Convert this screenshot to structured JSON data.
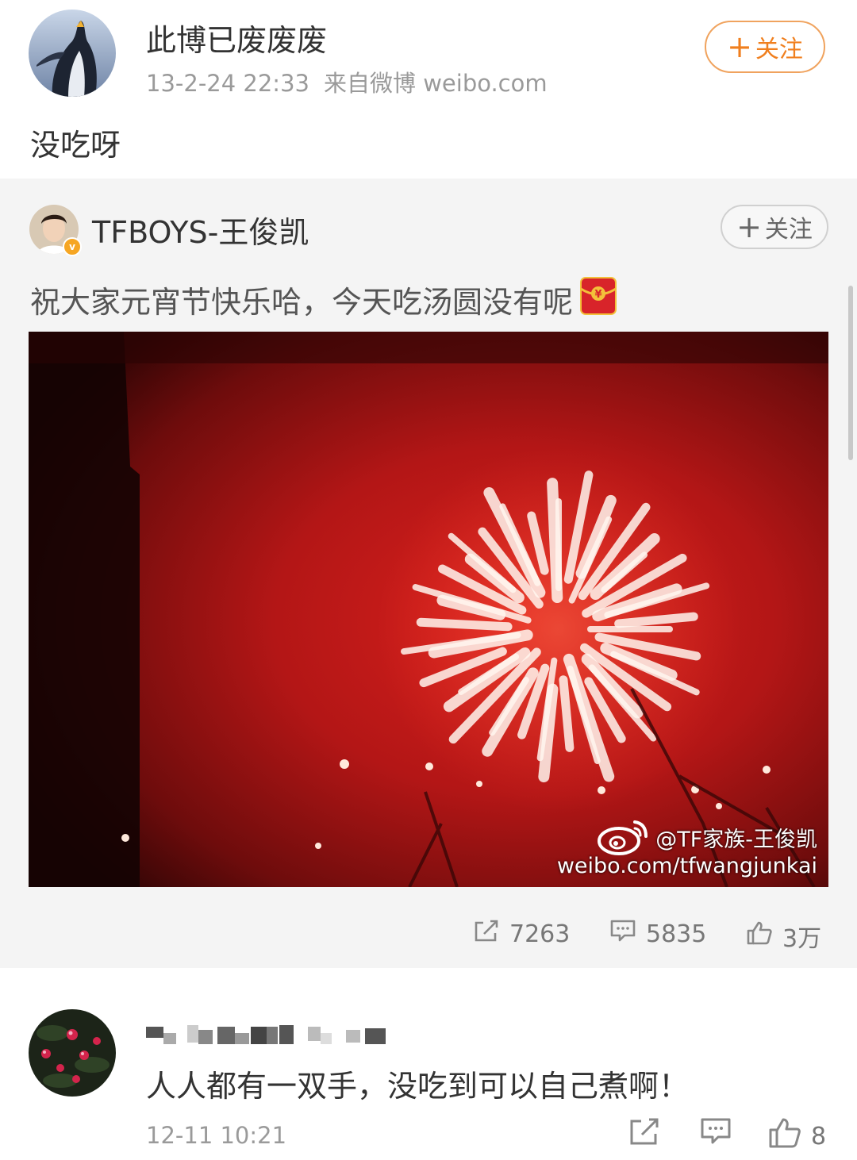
{
  "post": {
    "author": "此博已废废废",
    "time": "13-2-24 22:33",
    "source": "来自微博 weibo.com",
    "follow_label": "关注",
    "text": "没吃呀"
  },
  "repost": {
    "author": "TFBOYS-王俊凯",
    "follow_label": "关注",
    "text": "祝大家元宵节快乐哈，今天吃汤圆没有呢",
    "watermark_handle": "@TF家族-王俊凯",
    "watermark_url": "weibo.com/tfwangjunkai",
    "stats": {
      "reposts": "7263",
      "comments": "5835",
      "likes": "3万"
    }
  },
  "comment": {
    "text": "人人都有一双手，没吃到可以自己煮啊！",
    "time": "12-11 10:21",
    "likes": "8"
  },
  "colors": {
    "follow_accent": "#f07f1e",
    "muted_text": "#9a9a9a",
    "repost_bg": "#f4f4f4",
    "firework_red": "#b01414"
  }
}
